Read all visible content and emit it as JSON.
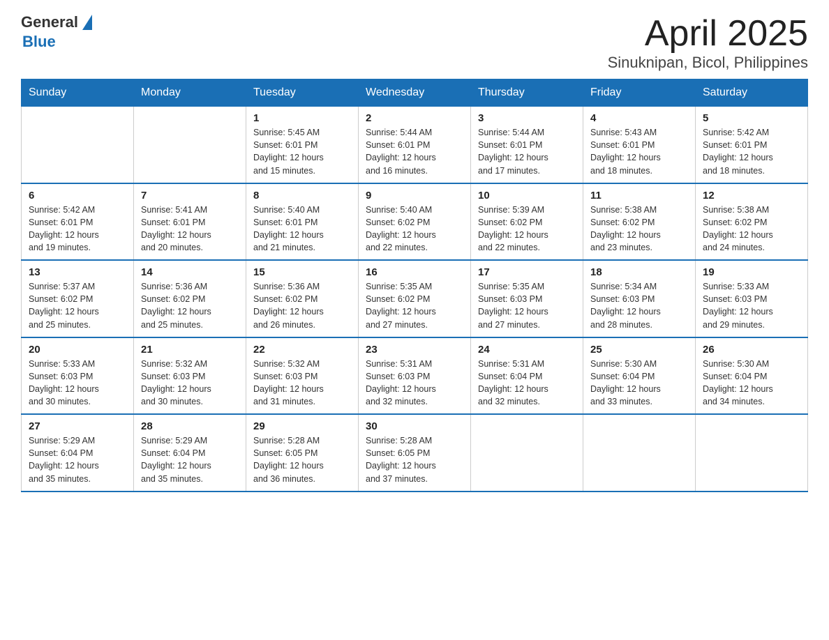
{
  "header": {
    "logo_general": "General",
    "logo_blue": "Blue",
    "title": "April 2025",
    "subtitle": "Sinuknipan, Bicol, Philippines"
  },
  "weekdays": [
    "Sunday",
    "Monday",
    "Tuesday",
    "Wednesday",
    "Thursday",
    "Friday",
    "Saturday"
  ],
  "weeks": [
    [
      {
        "day": "",
        "info": ""
      },
      {
        "day": "",
        "info": ""
      },
      {
        "day": "1",
        "info": "Sunrise: 5:45 AM\nSunset: 6:01 PM\nDaylight: 12 hours\nand 15 minutes."
      },
      {
        "day": "2",
        "info": "Sunrise: 5:44 AM\nSunset: 6:01 PM\nDaylight: 12 hours\nand 16 minutes."
      },
      {
        "day": "3",
        "info": "Sunrise: 5:44 AM\nSunset: 6:01 PM\nDaylight: 12 hours\nand 17 minutes."
      },
      {
        "day": "4",
        "info": "Sunrise: 5:43 AM\nSunset: 6:01 PM\nDaylight: 12 hours\nand 18 minutes."
      },
      {
        "day": "5",
        "info": "Sunrise: 5:42 AM\nSunset: 6:01 PM\nDaylight: 12 hours\nand 18 minutes."
      }
    ],
    [
      {
        "day": "6",
        "info": "Sunrise: 5:42 AM\nSunset: 6:01 PM\nDaylight: 12 hours\nand 19 minutes."
      },
      {
        "day": "7",
        "info": "Sunrise: 5:41 AM\nSunset: 6:01 PM\nDaylight: 12 hours\nand 20 minutes."
      },
      {
        "day": "8",
        "info": "Sunrise: 5:40 AM\nSunset: 6:01 PM\nDaylight: 12 hours\nand 21 minutes."
      },
      {
        "day": "9",
        "info": "Sunrise: 5:40 AM\nSunset: 6:02 PM\nDaylight: 12 hours\nand 22 minutes."
      },
      {
        "day": "10",
        "info": "Sunrise: 5:39 AM\nSunset: 6:02 PM\nDaylight: 12 hours\nand 22 minutes."
      },
      {
        "day": "11",
        "info": "Sunrise: 5:38 AM\nSunset: 6:02 PM\nDaylight: 12 hours\nand 23 minutes."
      },
      {
        "day": "12",
        "info": "Sunrise: 5:38 AM\nSunset: 6:02 PM\nDaylight: 12 hours\nand 24 minutes."
      }
    ],
    [
      {
        "day": "13",
        "info": "Sunrise: 5:37 AM\nSunset: 6:02 PM\nDaylight: 12 hours\nand 25 minutes."
      },
      {
        "day": "14",
        "info": "Sunrise: 5:36 AM\nSunset: 6:02 PM\nDaylight: 12 hours\nand 25 minutes."
      },
      {
        "day": "15",
        "info": "Sunrise: 5:36 AM\nSunset: 6:02 PM\nDaylight: 12 hours\nand 26 minutes."
      },
      {
        "day": "16",
        "info": "Sunrise: 5:35 AM\nSunset: 6:02 PM\nDaylight: 12 hours\nand 27 minutes."
      },
      {
        "day": "17",
        "info": "Sunrise: 5:35 AM\nSunset: 6:03 PM\nDaylight: 12 hours\nand 27 minutes."
      },
      {
        "day": "18",
        "info": "Sunrise: 5:34 AM\nSunset: 6:03 PM\nDaylight: 12 hours\nand 28 minutes."
      },
      {
        "day": "19",
        "info": "Sunrise: 5:33 AM\nSunset: 6:03 PM\nDaylight: 12 hours\nand 29 minutes."
      }
    ],
    [
      {
        "day": "20",
        "info": "Sunrise: 5:33 AM\nSunset: 6:03 PM\nDaylight: 12 hours\nand 30 minutes."
      },
      {
        "day": "21",
        "info": "Sunrise: 5:32 AM\nSunset: 6:03 PM\nDaylight: 12 hours\nand 30 minutes."
      },
      {
        "day": "22",
        "info": "Sunrise: 5:32 AM\nSunset: 6:03 PM\nDaylight: 12 hours\nand 31 minutes."
      },
      {
        "day": "23",
        "info": "Sunrise: 5:31 AM\nSunset: 6:03 PM\nDaylight: 12 hours\nand 32 minutes."
      },
      {
        "day": "24",
        "info": "Sunrise: 5:31 AM\nSunset: 6:04 PM\nDaylight: 12 hours\nand 32 minutes."
      },
      {
        "day": "25",
        "info": "Sunrise: 5:30 AM\nSunset: 6:04 PM\nDaylight: 12 hours\nand 33 minutes."
      },
      {
        "day": "26",
        "info": "Sunrise: 5:30 AM\nSunset: 6:04 PM\nDaylight: 12 hours\nand 34 minutes."
      }
    ],
    [
      {
        "day": "27",
        "info": "Sunrise: 5:29 AM\nSunset: 6:04 PM\nDaylight: 12 hours\nand 35 minutes."
      },
      {
        "day": "28",
        "info": "Sunrise: 5:29 AM\nSunset: 6:04 PM\nDaylight: 12 hours\nand 35 minutes."
      },
      {
        "day": "29",
        "info": "Sunrise: 5:28 AM\nSunset: 6:05 PM\nDaylight: 12 hours\nand 36 minutes."
      },
      {
        "day": "30",
        "info": "Sunrise: 5:28 AM\nSunset: 6:05 PM\nDaylight: 12 hours\nand 37 minutes."
      },
      {
        "day": "",
        "info": ""
      },
      {
        "day": "",
        "info": ""
      },
      {
        "day": "",
        "info": ""
      }
    ]
  ]
}
